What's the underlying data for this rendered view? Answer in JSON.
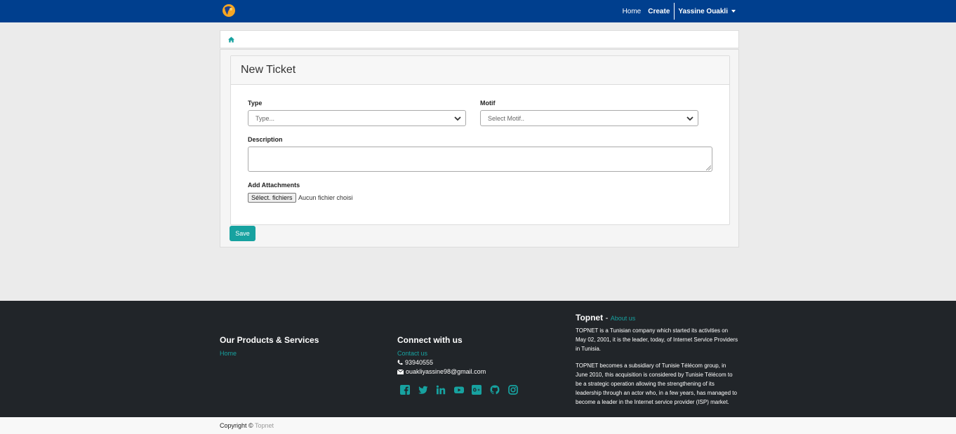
{
  "navbar": {
    "home_label": "Home",
    "create_label": "Create",
    "user_name": "Yassine Ouakli",
    "bg_color": "#003f8e"
  },
  "breadcrumb": {
    "icon": "home-icon"
  },
  "form": {
    "title": "New Ticket",
    "type_label": "Type",
    "type_placeholder": "Type...",
    "motif_label": "Motif",
    "motif_placeholder": "Select Motif..",
    "description_label": "Description",
    "attachments_label": "Add Attachments",
    "file_button_label": "Sélect. fichiers",
    "file_status": "Aucun fichier choisi",
    "save_label": "Save"
  },
  "footer": {
    "products_heading": "Our Products & Services",
    "products_links": [
      "Home"
    ],
    "connect_heading": "Connect with us",
    "contact_link": "Contact us",
    "phone": "93940555",
    "email": "ouakliyassine98@gmail.com",
    "socials": [
      "facebook-icon",
      "twitter-icon",
      "linkedin-icon",
      "youtube-icon",
      "google-plus-icon",
      "github-icon",
      "instagram-icon"
    ],
    "about_title": "Topnet",
    "about_separator": " - ",
    "about_link": "About us",
    "about_p1": "TOPNET is a Tunisian company which started its activities on May 02, 2001, it is the leader, today, of Internet Service Providers in Tunisia.",
    "about_p2": "TOPNET becomes a subsidiary of Tunisie Télécom group, in June 2010, this acquisition is considered by Tunisie Télécom to be a strategic operation allowing the strengthening of its leadership through an actor who, in a few years, has managed to become a leader in the Internet service provider (ISP) market."
  },
  "copyright": {
    "text": "Copyright © ",
    "brand": "Topnet"
  },
  "colors": {
    "accent": "#17a2a0",
    "footer_bg": "#212529"
  }
}
